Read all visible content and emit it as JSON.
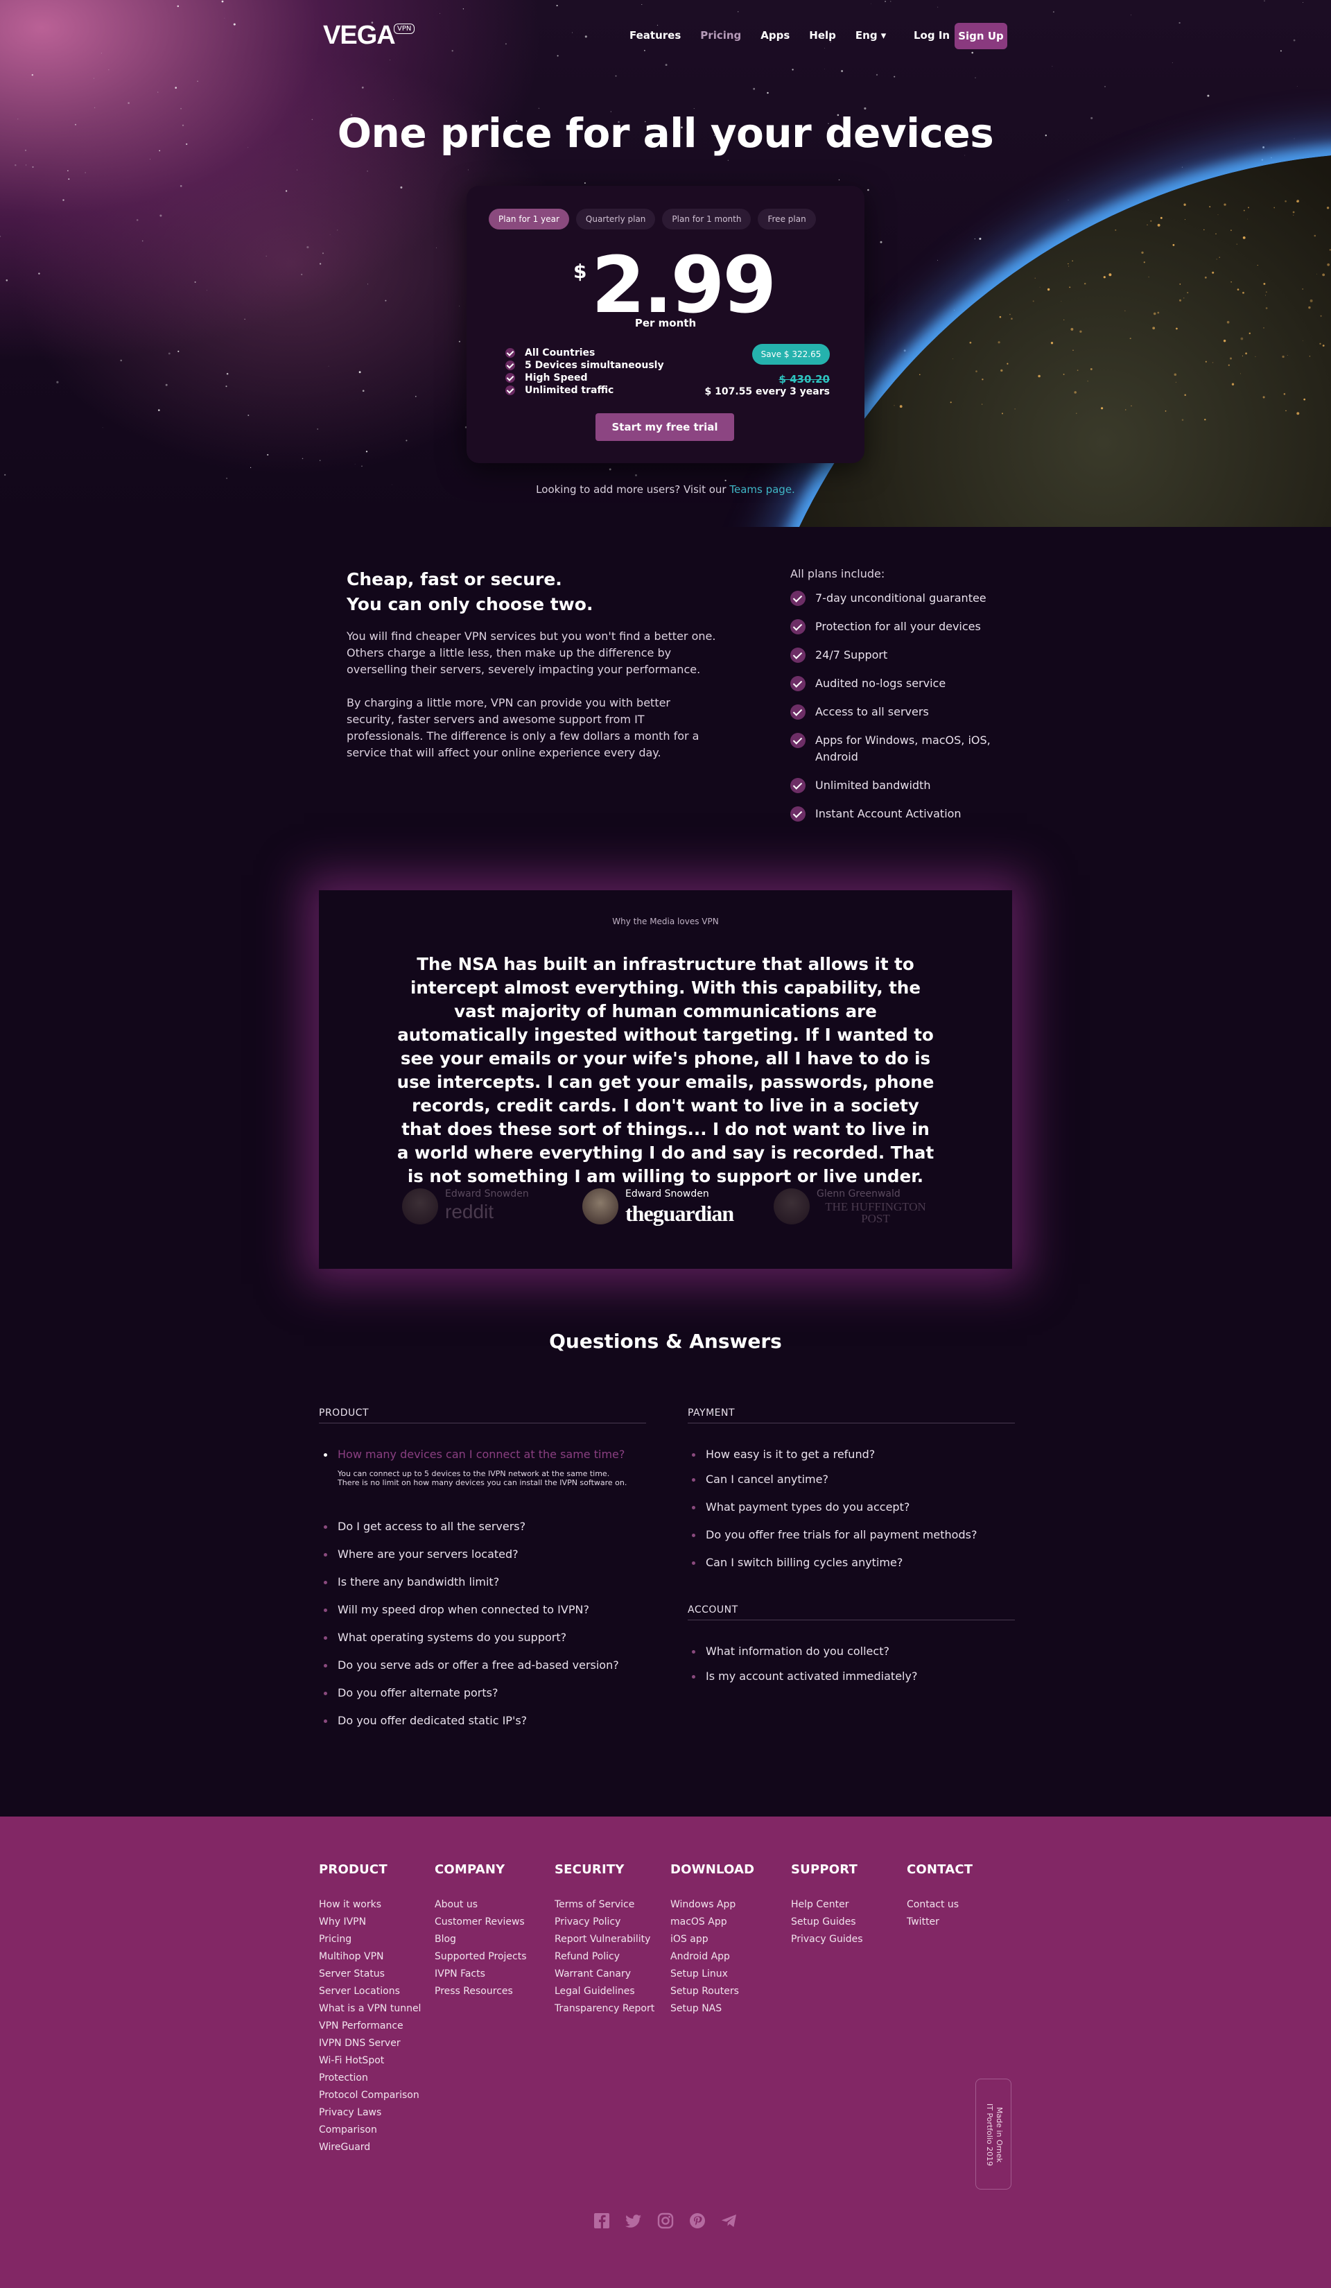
{
  "nav": {
    "logo": "VEGA",
    "logo_badge": "VPN",
    "links": [
      "Features",
      "Pricing",
      "Apps",
      "Help",
      "Eng ▾"
    ],
    "login": "Log In",
    "signup": "Sign Up"
  },
  "hero": {
    "title": "One price for all your devices"
  },
  "pricing": {
    "tabs": [
      "Plan for 1 year",
      "Quarterly plan",
      "Plan for 1 month",
      "Free plan"
    ],
    "active_tab": "Plan for 1 year",
    "currency": "$",
    "price": "2.99",
    "per": "Per month",
    "features": [
      "All Countries",
      "5 Devices simultaneously",
      "High Speed",
      "Unlimited traffic"
    ],
    "save_badge": "Save $ 322.65",
    "old_price": "$ 430.20",
    "total_price": "$ 107.55 every 3 years",
    "cta": "Start my free trial",
    "teams_prefix": "Looking to add more users? Visit our",
    "teams_link": "Teams page."
  },
  "why": {
    "title_line1": "Cheap, fast or secure.",
    "title_line2": "You can only choose two.",
    "p1": "You will find cheaper VPN services but you won't find a better one. Others charge a little less, then make up the difference by overselling their servers, severely impacting your performance.",
    "p2": "By charging a little more, VPN can provide you with better security, faster servers and awesome support from IT professionals. The difference is only a few dollars a month for a service that will affect your online experience every day.",
    "plans_head": "All plans include:",
    "plans": [
      "7-day unconditional guarantee",
      "Protection for all your devices",
      "24/7 Support",
      "Audited no-logs service",
      "Access to all servers",
      "Apps for Windows, macOS, iOS, Android",
      "Unlimited bandwidth",
      "Instant Account Activation"
    ]
  },
  "media": {
    "label": "Why the Media loves VPN",
    "quote": "The NSA has built an infrastructure that allows it to intercept almost everything. With this capability, the vast majority of human communications are automatically ingested without targeting. If I wanted to see your emails or your wife's phone, all I have to do is use intercepts. I can get your emails, passwords, phone records, credit cards. I don't want to live in a society that does these sort of things... I do not want to live in a world where everything I do and say is recorded. That is not something I am willing to support or live under.",
    "sources": [
      {
        "name": "Edward Snowden",
        "brand": "reddit"
      },
      {
        "name": "Edward Snowden",
        "brand": "theguardian"
      },
      {
        "name": "Glenn Greenwald",
        "brand": "THE HUFFINGTON POST"
      }
    ]
  },
  "qa": {
    "title": "Questions & Answers",
    "product_head": "PRODUCT",
    "product": [
      "How many devices can I connect at the same time?",
      "Do I get access to all the servers?",
      "Where are your servers located?",
      "Is there any bandwidth limit?",
      "Will my speed drop when connected to IVPN?",
      "What operating systems do you support?",
      "Do you serve ads or offer a free ad-based version?",
      "Do you offer alternate ports?",
      "Do you offer dedicated static IP's?"
    ],
    "answer": "You can connect up to 5 devices to the IVPN network at the same time. There is no limit on how many devices you can install the IVPN software on.",
    "payment_head": "PAYMENT",
    "payment": [
      "How easy is it to get a refund?",
      "Can I cancel anytime?",
      "What payment types do you accept?",
      "Do you offer free trials for all payment methods?",
      "Can I switch billing cycles anytime?"
    ],
    "account_head": "ACCOUNT",
    "account": [
      "What information do you collect?",
      "Is my account activated immediately?"
    ]
  },
  "footer": {
    "columns": [
      {
        "head": "PRODUCT",
        "links": [
          "How it works",
          "Why IVPN",
          "Pricing",
          "Multihop VPN",
          "Server Status",
          "Server Locations",
          "What is a VPN tunnel",
          "VPN Performance",
          "IVPN DNS Server",
          "Wi-Fi HotSpot",
          "Protection",
          "Protocol Comparison",
          "Privacy Laws",
          "Comparison",
          "WireGuard"
        ]
      },
      {
        "head": "COMPANY",
        "links": [
          "About us",
          "Customer Reviews",
          "Blog",
          "Supported Projects",
          "IVPN Facts",
          "Press Resources"
        ]
      },
      {
        "head": "SECURITY",
        "links": [
          "Terms of Service",
          "Privacy Policy",
          "Report Vulnerability",
          "Refund Policy",
          "Warrant Canary",
          "Legal Guidelines",
          "Transparency Report"
        ]
      },
      {
        "head": "DOWNLOAD",
        "links": [
          "Windows App",
          "macOS App",
          "iOS app",
          "Android App",
          "Setup Linux",
          "Setup Routers",
          "Setup NAS"
        ]
      },
      {
        "head": "SUPPORT",
        "links": [
          "Help Center",
          "Setup Guides",
          "Privacy Guides"
        ]
      },
      {
        "head": "CONTACT",
        "links": [
          "Contact us",
          "Twitter"
        ]
      }
    ],
    "made_line1": "Made in Ornek",
    "made_line2": "IT Portfolio 2019",
    "socials": [
      "facebook-icon",
      "twitter-icon",
      "instagram-icon",
      "pinterest-icon",
      "telegram-icon"
    ]
  },
  "colors": {
    "background": "#12071a",
    "accent": "#8a3a7f",
    "teal": "#25b2ad",
    "footer": "#822765"
  }
}
